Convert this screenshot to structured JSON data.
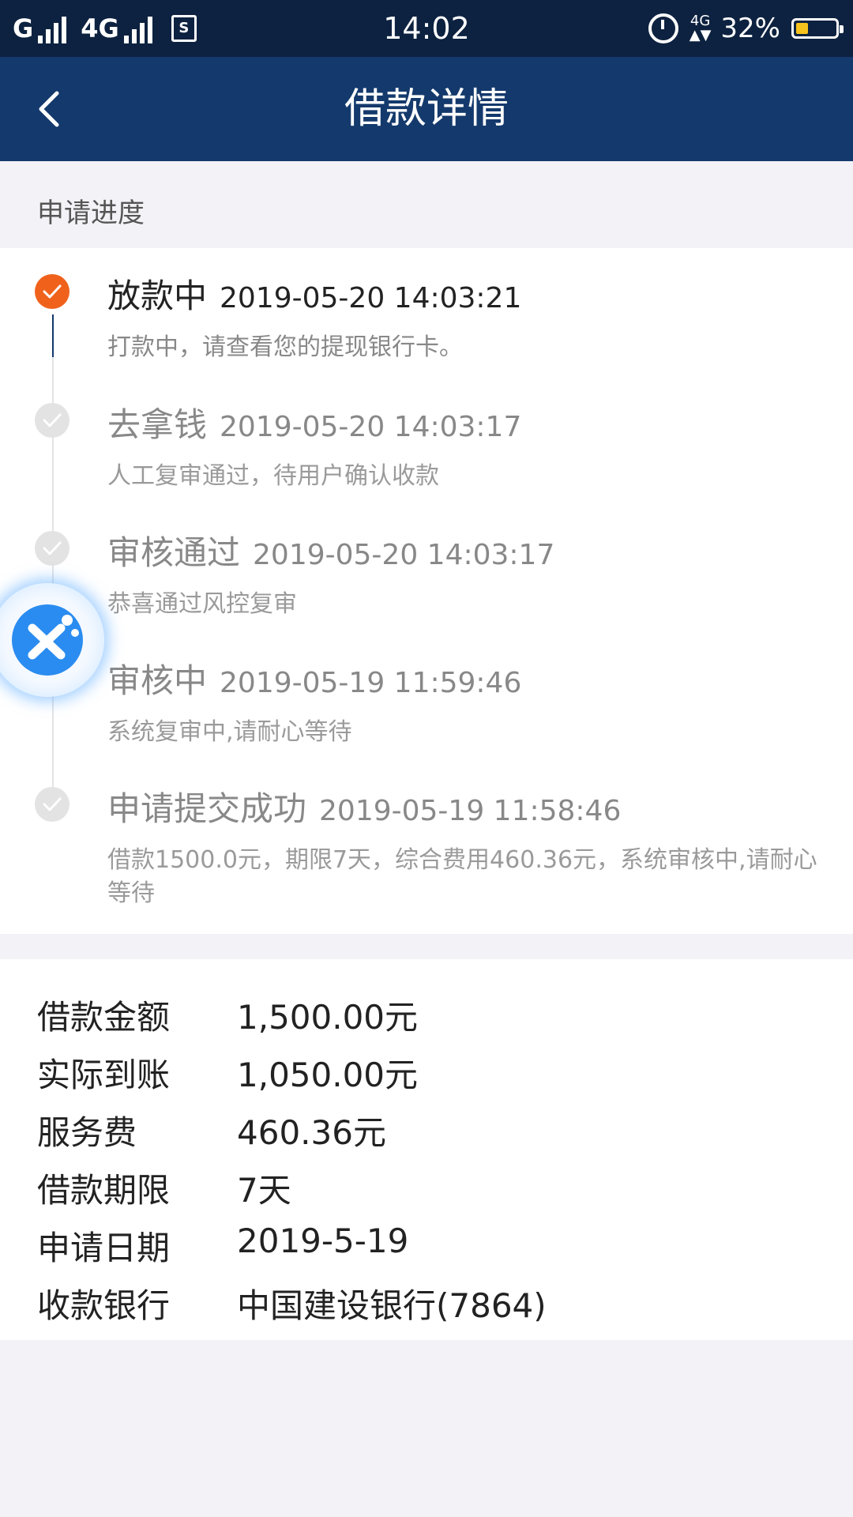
{
  "status_bar": {
    "carrier1": "G",
    "carrier2": "4G",
    "sim_label": "S",
    "time": "14:02",
    "network_badge_top": "4G",
    "network_badge_bottom": "▲▼",
    "battery": "32%",
    "battery_level": 0.32,
    "battery_color": "#f6c21c",
    "icons": [
      "signal-icon",
      "sim-icon",
      "alarm-icon",
      "battery-icon"
    ]
  },
  "nav": {
    "title": "借款详情",
    "back_icon": "chevron-left-icon"
  },
  "section_title": "申请进度",
  "timeline": [
    {
      "title": "放款中",
      "time": "2019-05-20 14:03:21",
      "desc": "打款中，请查看您的提现银行卡。",
      "status": "current"
    },
    {
      "title": "去拿钱",
      "time": "2019-05-20 14:03:17",
      "desc": "人工复审通过，待用户确认收款",
      "status": "done"
    },
    {
      "title": "审核通过",
      "time": "2019-05-20 14:03:17",
      "desc": "恭喜通过风控复审",
      "status": "done"
    },
    {
      "title": "审核中",
      "time": "2019-05-19 11:59:46",
      "desc": "系统复审中,请耐心等待",
      "status": "done"
    },
    {
      "title": "申请提交成功",
      "time": "2019-05-19 11:58:46",
      "desc": "借款1500.0元，期限7天，综合费用460.36元，系统审核中,请耐心等待",
      "status": "done"
    }
  ],
  "details": [
    {
      "label": "借款金额",
      "value": "1,500.00元"
    },
    {
      "label": "实际到账",
      "value": "1,050.00元"
    },
    {
      "label": "服务费",
      "value": "460.36元"
    },
    {
      "label": "借款期限",
      "value": "7天"
    },
    {
      "label": "申请日期",
      "value": "2019-5-19"
    },
    {
      "label": "收款银行",
      "value": "中国建设银行(7864)"
    }
  ],
  "colors": {
    "header_bg": "#14396c",
    "status_bg": "#0d2240",
    "accent": "#f0621c"
  }
}
